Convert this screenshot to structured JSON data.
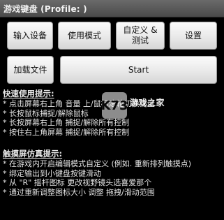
{
  "window": {
    "title": "游戏键盘 (Profile: )"
  },
  "buttons": {
    "input_device": "输入设备",
    "usage_mode": "使用模式",
    "customize_test": "自定义 &\n测试",
    "settings": "设置",
    "load_file": "加载文件",
    "start": "Start"
  },
  "quick_tips": {
    "heading": "快速使用提示:",
    "items": [
      "* 点击屏幕右上角 音量 上/鼠标滚轮切换键盘",
      "* 长按鼠标捕捉/解除鼠标",
      "* 长按屏幕右上角 捕捉/解除所有控制",
      "* 按住右上角屏幕 捕捉/解除所有控制"
    ]
  },
  "touch_tips": {
    "heading": "触摸屏仿真提示:",
    "items": [
      "* 在游戏内开启编辑模式自定义 (例如. 重新排列触摸点)",
      "* 绑定输出到小键盘按键滑动",
      "* 从 \"R\" 摇杆图标 更改视野镜头选喜爱那个",
      "* 通过重新调整图标大小 调整 拖拽/滑动范围"
    ]
  },
  "watermark": {
    "logo": "K73",
    "text": "游戏之家"
  }
}
